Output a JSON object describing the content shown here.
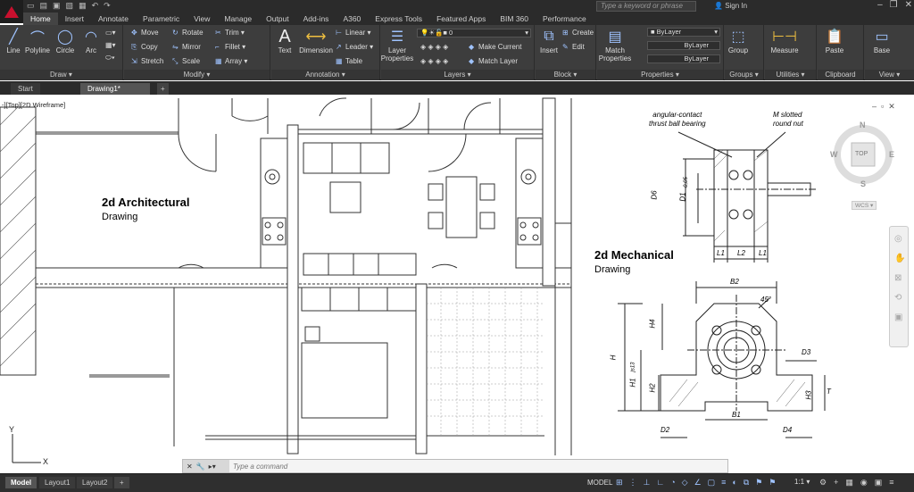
{
  "app": {
    "search_placeholder": "Type a keyword or phrase",
    "sign_in": "Sign In"
  },
  "ribbon_tabs": [
    "Home",
    "Insert",
    "Annotate",
    "Parametric",
    "View",
    "Manage",
    "Output",
    "Add-ins",
    "A360",
    "Express Tools",
    "Featured Apps",
    "BIM 360",
    "Performance"
  ],
  "panels": {
    "draw": {
      "title": "Draw",
      "tools": {
        "line": "Line",
        "polyline": "Polyline",
        "circle": "Circle",
        "arc": "Arc"
      }
    },
    "modify": {
      "title": "Modify",
      "tools": {
        "move": "Move",
        "rotate": "Rotate",
        "trim": "Trim",
        "copy": "Copy",
        "mirror": "Mirror",
        "fillet": "Fillet",
        "stretch": "Stretch",
        "scale": "Scale",
        "array": "Array"
      }
    },
    "annotation": {
      "title": "Annotation",
      "tools": {
        "text": "Text",
        "dimension": "Dimension",
        "linear": "Linear",
        "leader": "Leader",
        "table": "Table"
      }
    },
    "layers": {
      "title": "Layers",
      "tools": {
        "layer_properties": "Layer Properties",
        "make_current": "Make Current",
        "match_layer": "Match Layer",
        "layer_value": "0"
      }
    },
    "block": {
      "title": "Block",
      "tools": {
        "insert": "Insert",
        "create": "Create",
        "edit": "Edit"
      }
    },
    "properties": {
      "title": "Properties",
      "tools": {
        "match_properties": "Match Properties",
        "color": "ByLayer",
        "linetype": "ByLayer",
        "lineweight": "ByLayer"
      }
    },
    "groups": {
      "title": "Groups",
      "tools": {
        "group": "Group"
      }
    },
    "utilities": {
      "title": "Utilities",
      "tools": {
        "measure": "Measure"
      }
    },
    "clipboard": {
      "title": "Clipboard",
      "tools": {
        "paste": "Paste"
      }
    },
    "view": {
      "title": "View",
      "tools": {
        "base": "Base"
      }
    }
  },
  "doc_tabs": [
    "Start",
    "Drawing1*"
  ],
  "viewport_label": "-][Top][2D Wireframe]",
  "drawing": {
    "arch_title": "2d Architectural",
    "arch_sub": "Drawing",
    "mech_title": "2d Mechanical",
    "mech_sub": "Drawing",
    "callout1": [
      "angular-contact",
      "thrust ball bearing"
    ],
    "callout2": [
      "M slotted",
      "round nut"
    ],
    "dims": {
      "d6": "D6",
      "d1": "D1",
      "tol": "-0,05",
      "l1": "L1",
      "l2": "L2",
      "l1b": "L1",
      "b2": "B2",
      "angle": "45°",
      "h4": "H4",
      "h": "H",
      "h1": "H1",
      "h1tol": "js13",
      "h2": "H2",
      "d3": "D3",
      "h3": "H3",
      "t": "T",
      "b1": "B1",
      "d2": "D2",
      "d4": "D4"
    }
  },
  "viewcube": {
    "n": "N",
    "s": "S",
    "e": "E",
    "w": "W",
    "top": "TOP",
    "wcs": "WCS"
  },
  "axes": {
    "x": "X",
    "y": "Y"
  },
  "command_placeholder": "Type a command",
  "layout_tabs": [
    "Model",
    "Layout1",
    "Layout2"
  ],
  "status": {
    "model": "MODEL",
    "scale": "1:1"
  },
  "colors": {
    "ribbon_bg": "#3d3d3d",
    "title_bg": "#2b2b2b",
    "accent": "#9fc3ff",
    "brand": "#c8102e"
  }
}
